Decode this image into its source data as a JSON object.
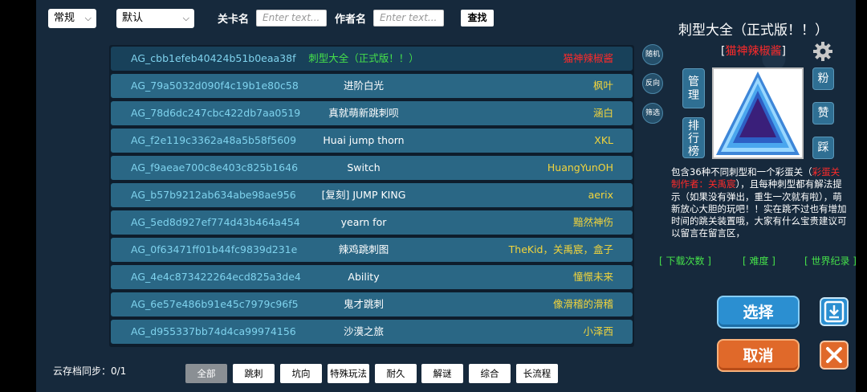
{
  "filters": {
    "sort_type": "常规",
    "order": "默认",
    "level_name_label": "关卡名",
    "level_name_placeholder": "Enter text...",
    "author_label": "作者名",
    "author_placeholder": "Enter text...",
    "search_label": "查找"
  },
  "levels": [
    {
      "id": "AG_cbb1efeb40424b51b0eaa38f",
      "name": "刺型大全（正式版！！）",
      "author": "猫神辣椒酱"
    },
    {
      "id": "AG_79a5032d090f4c19b1e80c58",
      "name": "进阶白光",
      "author": "枫叶"
    },
    {
      "id": "AG_78d6dc247cbc422db7aa0519",
      "name": "真就萌新跳刺呗",
      "author": "涵白"
    },
    {
      "id": "AG_f2e119c3362a48a5b58f5609",
      "name": "Huai jump thorn",
      "author": "XKL"
    },
    {
      "id": "AG_f9aeae700c8e403c825b1646",
      "name": "Switch",
      "author": "HuangYunOH"
    },
    {
      "id": "AG_b57b9212ab634abe98ae956",
      "name": "[复刻] JUMP KING",
      "author": "aerix"
    },
    {
      "id": "AG_5ed8d927ef774d43b464a454",
      "name": "yearn for",
      "author": "黯然神伤"
    },
    {
      "id": "AG_0f63471ff01b44fc9839d231e",
      "name": "辣鸡跳刺图",
      "author": "TheKid，关禹宸，盒子"
    },
    {
      "id": "AG_4e4c873422264ecd825a3de4",
      "name": "Ability",
      "author": "憧憬未来"
    },
    {
      "id": "AG_6e57e486b91e45c7979c96f5",
      "name": "鬼才跳刺",
      "author": "像滑稽的滑稽"
    },
    {
      "id": "AG_d955337bb74d4ca99974156",
      "name": "沙漠之旅",
      "author": "小泽西"
    }
  ],
  "side_buttons": {
    "random": "随机",
    "reverse": "反向",
    "filter": "筛选"
  },
  "detail": {
    "title": "刺型大全（正式版！！）",
    "bracket_open": "[",
    "author": "猫神辣椒酱",
    "bracket_close": "]",
    "manage": "管理",
    "ranking": "排行榜",
    "fan": "粉",
    "like": "赞",
    "dislike": "踩",
    "desc_part1": "包含36种不同刺型和一个彩蛋关（",
    "desc_red": "彩蛋关制作者：关禹宸",
    "desc_part2": "），且每种刺型都有解法提示（如果没有弹出，重生一次就有啦），萌新放心大胆的玩吧！！实在跳不过也有增加时间的跳关装置哦，大家有什么宝贵建议可以留言在留言区，",
    "downloads": "[ 下载次数 ]",
    "difficulty": "[ 难度 ]",
    "world_record": "[ 世界纪录 ]",
    "select": "选择",
    "cancel": "取消"
  },
  "footer": {
    "sync": "云存档同步：0/1",
    "categories": [
      "全部",
      "跳刺",
      "坑向",
      "特殊玩法",
      "耐久",
      "解谜",
      "综合",
      "长流程"
    ]
  }
}
